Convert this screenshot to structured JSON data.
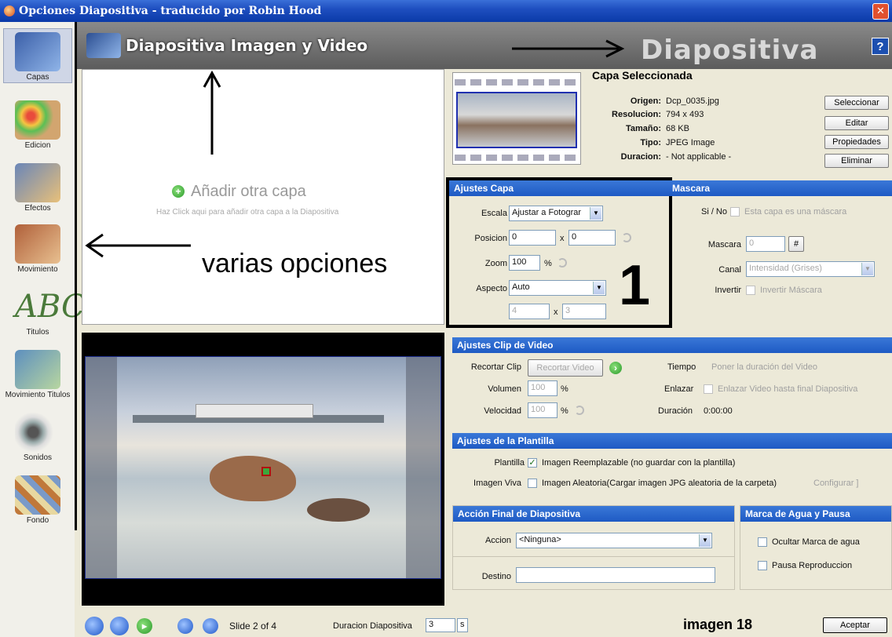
{
  "window": {
    "title": "Opciones Diapositiva - traducido por Robin Hood",
    "close_glyph": "✕"
  },
  "sidebar": {
    "items": [
      {
        "label": "Capas",
        "icon": "layers-icon"
      },
      {
        "label": "Edicion",
        "icon": "palette-icon"
      },
      {
        "label": "Efectos",
        "icon": "effects-icon"
      },
      {
        "label": "Movimiento",
        "icon": "motion-icon"
      },
      {
        "label": "Titulos",
        "icon": "titles-icon"
      },
      {
        "label": "Movimiento Titulos",
        "icon": "title-motion-icon"
      },
      {
        "label": "Sonidos",
        "icon": "sound-icon"
      },
      {
        "label": "Fondo",
        "icon": "background-icon"
      }
    ]
  },
  "header": {
    "title": "Diapositiva Imagen y Video",
    "big_label": "Diapositiva",
    "help": "?"
  },
  "layer_area": {
    "add_label": "Añadir otra capa",
    "add_hint": "Haz Click aqui para añadir otra capa a la Diapositiva"
  },
  "annotations": {
    "options_text": "varias opciones",
    "number": "1",
    "image_label": "imagen 18"
  },
  "selected_layer": {
    "title": "Capa Seleccionada",
    "origen_label": "Origen:",
    "origen": "Dcp_0035.jpg",
    "resolucion_label": "Resolucion:",
    "resolucion": "794 x 493",
    "tamano_label": "Tamaño:",
    "tamano": "68 KB",
    "tipo_label": "Tipo:",
    "tipo": "JPEG Image",
    "duracion_label": "Duracion:",
    "duracion": "- Not applicable -",
    "buttons": {
      "select": "Seleccionar",
      "edit": "Editar",
      "props": "Propiedades",
      "delete": "Eliminar"
    }
  },
  "ajustes_capa": {
    "title": "Ajustes Capa",
    "escala_label": "Escala",
    "escala_value": "Ajustar a Fotograr",
    "posicion_label": "Posicion",
    "pos_x": "0",
    "pos_sep": "x",
    "pos_y": "0",
    "zoom_label": "Zoom",
    "zoom_value": "100",
    "zoom_unit": "%",
    "aspecto_label": "Aspecto",
    "aspecto_value": "Auto",
    "aspect_w": "4",
    "aspect_sep": "x",
    "aspect_h": "3"
  },
  "mascara": {
    "title": "Mascara",
    "sino_label": "Si / No",
    "sino_text": "Esta capa es una máscara",
    "mascara_label": "Mascara",
    "mascara_value": "0",
    "hash": "#",
    "canal_label": "Canal",
    "canal_value": "Intensidad (Grises)",
    "invertir_label": "Invertir",
    "invertir_text": "Invertir Máscara"
  },
  "video": {
    "title": "Ajustes Clip de Video",
    "recortar_label": "Recortar Clip",
    "recortar_btn": "Recortar Video",
    "volumen_label": "Volumen",
    "volumen_value": "100",
    "volumen_unit": "%",
    "velocidad_label": "Velocidad",
    "velocidad_value": "100",
    "velocidad_unit": "%",
    "tiempo_label": "Tiempo",
    "tiempo_text": "Poner la duración del Video",
    "enlazar_label": "Enlazar",
    "enlazar_text": "Enlazar Video hasta final Diapositiva",
    "duracion_label": "Duración",
    "duracion_value": "0:00:00"
  },
  "plantilla": {
    "title": "Ajustes de la Plantilla",
    "plantilla_label": "Plantilla",
    "plantilla_text": "Imagen Reemplazable (no guardar con la plantilla)",
    "viva_label": "Imagen Viva",
    "viva_text": "Imagen Aleatoria(Cargar imagen JPG aleatoria de la carpeta)",
    "configurar": "Configurar ]"
  },
  "accion": {
    "title": "Acción Final de Diapositiva",
    "accion_label": "Accion",
    "accion_value": "<Ninguna>",
    "destino_label": "Destino",
    "destino_value": ""
  },
  "marca": {
    "title": "Marca de Agua y Pausa",
    "ocultar": "Ocultar Marca de agua",
    "pausa": "Pausa Reproduccion"
  },
  "bottom": {
    "slide_label": "Slide 2 of 4",
    "duracion_label": "Duracion Diapositiva",
    "duracion_value": "3",
    "duracion_unit": "s",
    "accept": "Aceptar"
  }
}
